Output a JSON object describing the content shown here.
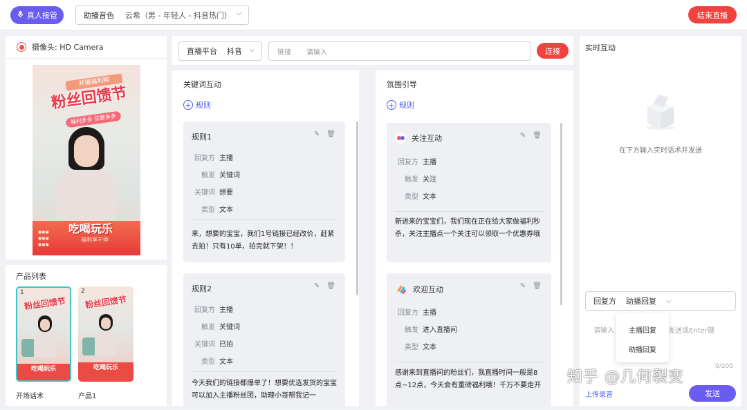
{
  "header": {
    "takeover_label": "真人接管",
    "voice_label": "助播音色",
    "voice_value": "云希（男 - 年轻人 - 抖音热门）",
    "end_live_label": "结束直播"
  },
  "camera": {
    "label": "摄像头: HD Camera",
    "preview": {
      "ribbon": "开播福利购",
      "title": "粉丝回馈节",
      "subtitle": "福利多多 优惠多多",
      "strip_title": "吃喝玩乐",
      "strip_sub": "福利享不停"
    }
  },
  "products": {
    "title": "产品列表",
    "items": [
      {
        "index": "1",
        "label": "开场话术",
        "mini_title": "粉丝回馈节",
        "strip": "吃喝玩乐"
      },
      {
        "index": "2",
        "label": "产品1",
        "mini_title": "粉丝回馈节",
        "strip": "吃喝玩乐"
      }
    ]
  },
  "toolbar": {
    "platform_label": "直播平台",
    "platform_value": "抖音",
    "link_label": "链接",
    "link_placeholder": "请输入",
    "connect_label": "连接"
  },
  "keyword": {
    "title": "关键词互动",
    "add_label": "规则",
    "rules": [
      {
        "name": "规则1",
        "rows": [
          {
            "k": "回复方",
            "v": "主播"
          },
          {
            "k": "触发",
            "v": "关键词"
          },
          {
            "k": "关键词",
            "v": "想要"
          },
          {
            "k": "类型",
            "v": "文本"
          }
        ],
        "text": "来，想要的宝宝，我们1号链接已经改价，赶紧去拍！只有10单，拍完就下架！！"
      },
      {
        "name": "规则2",
        "rows": [
          {
            "k": "回复方",
            "v": "主播"
          },
          {
            "k": "触发",
            "v": "关键词"
          },
          {
            "k": "关键词",
            "v": "已拍"
          },
          {
            "k": "类型",
            "v": "文本"
          }
        ],
        "text": "今天我们的链接都爆单了！想要优选发货的宝宝可以加入主播粉丝团，助理小哥帮我记一"
      }
    ]
  },
  "atmosphere": {
    "title": "氛围引导",
    "add_label": "规则",
    "rules": [
      {
        "name": "关注互动",
        "icon": "follow-icon",
        "rows": [
          {
            "k": "回复方",
            "v": "主播"
          },
          {
            "k": "触发",
            "v": "关注"
          },
          {
            "k": "类型",
            "v": "文本"
          }
        ],
        "text": "新进来的宝宝们，我们现在正在给大家做福利秒杀，关注主播点一个关注可以领取一个优惠券哦"
      },
      {
        "name": "欢迎互动",
        "icon": "welcome-icon",
        "rows": [
          {
            "k": "回复方",
            "v": "主播"
          },
          {
            "k": "触发",
            "v": "进入直播间"
          },
          {
            "k": "类型",
            "v": "文本"
          }
        ],
        "text": "感谢来到直播间的粉丝们，我直播时间一般是8点~12点，今天会有重磅福利哦！千万不要走开"
      }
    ]
  },
  "realtime": {
    "title": "实时互动",
    "empty_text": "在下方输入实时话术并发送",
    "reply_label": "回复方",
    "reply_value": "助播回复",
    "input_hint_left": "请输入",
    "input_hint_right": "发送或Enter键",
    "dropdown_options": [
      "主播回复",
      "助播回复"
    ],
    "counter": "0/200",
    "upload_label": "上传录音",
    "send_label": "发送"
  },
  "watermark": "知乎 @几何裂变",
  "colors": {
    "accent": "#6a5cf0",
    "danger": "#f0433f",
    "link": "#4a5ef0",
    "card_bg": "#eef0f4"
  }
}
